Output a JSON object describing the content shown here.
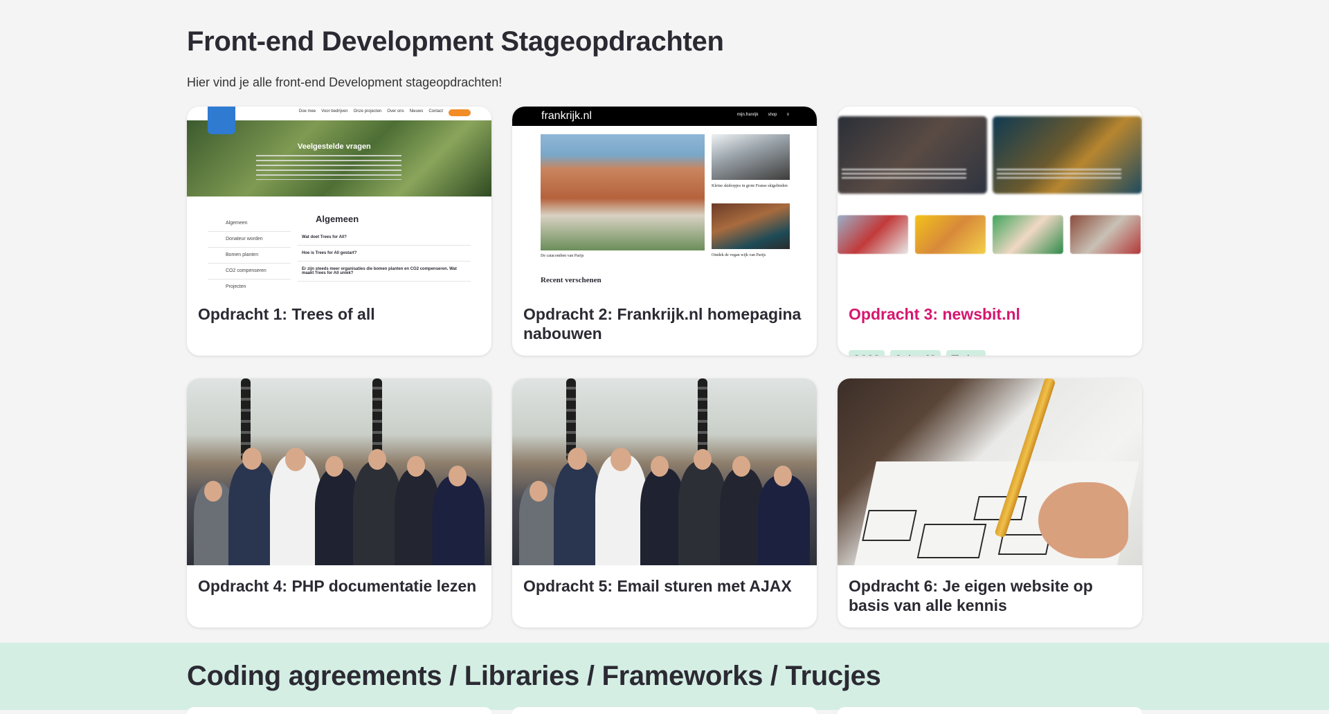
{
  "page": {
    "title": "Front-end Development Stageopdrachten",
    "subtitle": "Hier vind je alle front-end Development stageopdrachten!"
  },
  "cards": [
    {
      "title": "Opdracht 1: Trees of all",
      "image": "trees-for-all-screenshot"
    },
    {
      "title": "Opdracht 2: Frankrijk.nl homepagina nabouwen",
      "image": "frankrijk-homepage-screenshot"
    },
    {
      "title": "Opdracht 3: newsbit.nl",
      "image": "newsbit-screenshot",
      "accent_color": "#d6166f",
      "tags": [
        "SCSS",
        "SwiperJS",
        "Timber"
      ]
    },
    {
      "title": "Opdracht 4: PHP documentatie lezen",
      "image": "team-photo"
    },
    {
      "title": "Opdracht 5: Email sturen met AJAX",
      "image": "team-photo"
    },
    {
      "title": "Opdracht 6: Je eigen website op basis van alle kennis",
      "image": "wireframe-sketch-photo"
    }
  ],
  "thumb1": {
    "nav": [
      "Doe mee",
      "Voor bedrijven",
      "Onze projecten",
      "Over ons",
      "Nieuws",
      "Contact"
    ],
    "hero_title": "Veelgestelde vragen",
    "side_items": [
      "Algemeen",
      "Donateur worden",
      "Bomen planten",
      "CO2 compenseren",
      "Projecten"
    ],
    "main_heading": "Algemeen",
    "questions": [
      "Wat doet Trees for All?",
      "Hoe is Trees for All gestart?",
      "Er zijn steeds meer organisaties die bomen planten en CO2 compenseren. Wat maakt Trees for All uniek?"
    ]
  },
  "thumb2": {
    "logo": "frankrijk.nl",
    "menu": [
      "mijn.franrijk",
      "shop",
      "≡"
    ],
    "caption_big": "De catacomben van Parijs",
    "caption_s1": "Kleine skidorpjes in grote Franse skigebieden",
    "caption_s2": "Ontdek de vegan wijk van Parijs",
    "recent": "Recent verschenen"
  },
  "bottom": {
    "title": "Coding agreements / Libraries / Frameworks / Trucjes",
    "background": "#d4eee3"
  },
  "colors": {
    "page_bg": "#f4f4f4",
    "tag_bg": "#cfeee0",
    "accent": "#d6166f"
  }
}
